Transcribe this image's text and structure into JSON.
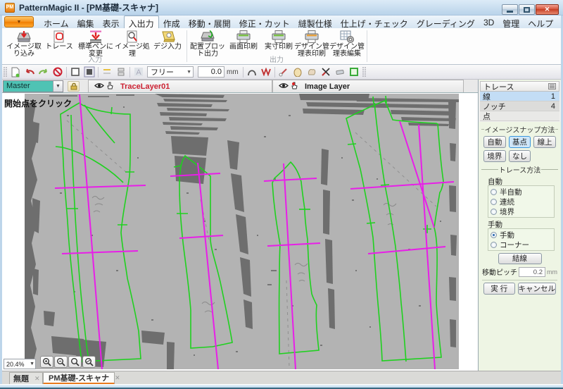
{
  "window": {
    "title": "PatternMagic II - [PM基礎-スキャナ]",
    "icon_text": "PM"
  },
  "menu": {
    "items": [
      "ホーム",
      "編集",
      "表示",
      "入出力",
      "作成",
      "移動・展開",
      "修正・カット",
      "縫製仕様",
      "仕上げ・チェック",
      "グレーディング",
      "3D",
      "管理",
      "ヘルプ"
    ]
  },
  "ribbon": {
    "groups": [
      {
        "label": "入力",
        "buttons": [
          {
            "label": "イメージ取\nり込み"
          },
          {
            "label": "トレース"
          },
          {
            "label": "標準ペンに\n変更"
          },
          {
            "label": "イメージ処\n理"
          },
          {
            "label": "デジ入力"
          }
        ]
      },
      {
        "label": "出力",
        "buttons": [
          {
            "label": "配置プロッ\nト出力"
          },
          {
            "label": "画面印刷"
          },
          {
            "label": "実寸印刷"
          },
          {
            "label": "デザイン管\n理表印刷"
          },
          {
            "label": "デザイン管\n理表編集"
          }
        ]
      }
    ]
  },
  "toolbar": {
    "mode_value": "フリー",
    "offset_value": "0.0",
    "offset_unit": "mm"
  },
  "layerbar": {
    "master_value": "Master",
    "layers": [
      {
        "name": "TraceLayer01"
      },
      {
        "name": "Image Layer"
      }
    ]
  },
  "canvas": {
    "message": "開始点をクリック",
    "zoom_value": "20.4%"
  },
  "panel": {
    "title": "トレース",
    "rows": [
      {
        "label": "線",
        "value": "1"
      },
      {
        "label": "ノッチ",
        "value": "4"
      },
      {
        "label": "点",
        "value": ""
      }
    ],
    "snap": {
      "legend": "イメージスナップ方法",
      "buttons": [
        "自動",
        "基点",
        "線上",
        "境界",
        "なし"
      ]
    },
    "trace_method": {
      "legend": "トレース方法",
      "auto_group": {
        "label": "自動",
        "options": [
          "半自動",
          "連続",
          "境界"
        ]
      },
      "manual_group": {
        "label": "手動",
        "options": [
          "手動",
          "コーナー"
        ],
        "selected": "手動"
      },
      "connect_button": "結線",
      "pitch_label": "移動ピッチ",
      "pitch_value": "0.2",
      "pitch_unit": "mm",
      "execute_button": "実 行",
      "cancel_button": "キャンセル"
    }
  },
  "doctabs": [
    {
      "label": "無題"
    },
    {
      "label": "PM基礎-スキャナ"
    }
  ]
}
